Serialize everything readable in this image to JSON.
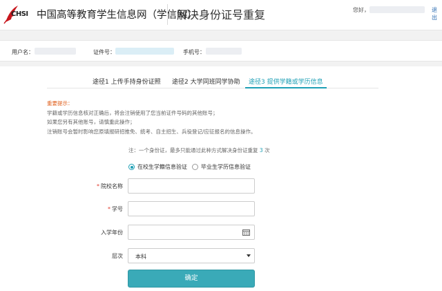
{
  "header": {
    "logo_text": "CHSI",
    "site_name": "中国高等教育学生信息网（学信网）",
    "page_title": "解决身份证号重复",
    "greeting": "您好，",
    "logout": "退出"
  },
  "infobar": {
    "username_label": "用户名：",
    "id_label": "证件号：",
    "phone_label": "手机号："
  },
  "tabs": [
    {
      "label": "途径1 上传手持身份证照",
      "active": false
    },
    {
      "label": "途径2 大学同班同学协助",
      "active": false
    },
    {
      "label": "途径3 提供学籍或学历信息",
      "active": true
    }
  ],
  "notice": {
    "title": "重要提示：",
    "lines": [
      "学籍或学历信息核对正确后，将会注销使用了您当前证件号码的其他账号；",
      "如果您另有其他账号，请慎重此操作；",
      "注销账号会暂时影响您原填报研招推免、统考、自主招生、兵役登记/应征报名的信息操作。"
    ]
  },
  "limit_note": {
    "prefix": "注：一个身份证，最多只能通过此种方式解决身份证重复",
    "count": "3",
    "suffix": "次"
  },
  "radios": [
    {
      "label": "在校生学籍信息验证",
      "checked": true
    },
    {
      "label": "毕业生学历信息验证",
      "checked": false
    }
  ],
  "form": {
    "school_label": "院校名称",
    "student_no_label": "学号",
    "enroll_year_label": "入学年份",
    "level_label": "层次",
    "level_value": "本科",
    "required_mark": "*",
    "submit_label": "确定"
  },
  "colors": {
    "accent": "#1d9fb5",
    "button": "#3aaab8",
    "warning": "#e0611f"
  }
}
